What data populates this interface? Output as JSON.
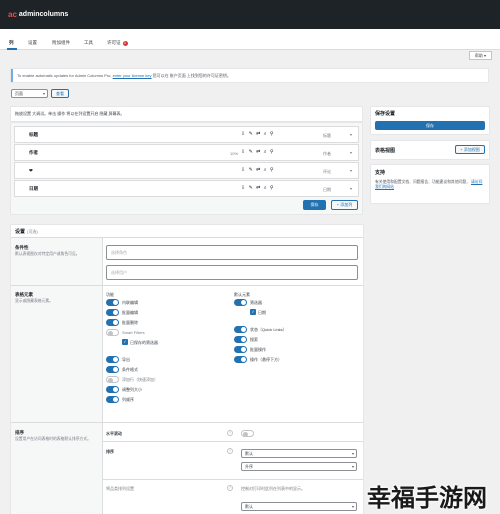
{
  "brand": {
    "mark": "ac",
    "name": "admincolumns"
  },
  "tabs": [
    {
      "label": "列"
    },
    {
      "label": "设置"
    },
    {
      "label": "附加组件"
    },
    {
      "label": "工具"
    },
    {
      "label": "许可证",
      "badge": "1"
    }
  ],
  "help_button": "帮助 ▾",
  "notice": {
    "text": "To enable automatic updates for Admin Columns Pro,",
    "link": "enter your license key",
    "text2": "您可以在 账户页面 上找到您的许可证密钥。"
  },
  "list_screen": {
    "select_value": "页面",
    "select_caret": "▾",
    "view_button": "查看"
  },
  "columns_intro": "拖放设置 大调试。单击 操作 将以在列设置开启 隐藏 屏幕表。",
  "columns": [
    {
      "label": "标题",
      "width": "",
      "type": "标题"
    },
    {
      "label": "作者",
      "width": "10%",
      "type": "作者"
    },
    {
      "label": "❤",
      "width": "",
      "type": "评论"
    },
    {
      "label": "日期",
      "width": "",
      "type": "日期"
    }
  ],
  "column_icons": "⇩ ✎ ⇄ ⌕ ⚲",
  "column_chevron": "▾",
  "save_button": "保存",
  "add_column_button": "+ 添加列",
  "sidebar": {
    "save_title": "保存设置",
    "save_button": "保存",
    "table_view_title": "表格视图",
    "add_view_button": "+ 添加视图",
    "support_title": "支持",
    "support_text": "有关使用和配置文档、问题报告、功能建议和其他问题，",
    "support_link": "请访问我们的网站"
  },
  "settings": {
    "title": "设置",
    "subtitle": "(可选)",
    "conditionals_label": "条件性",
    "conditionals_desc": "默认表视图仅对特定用户或角色可见。",
    "user_placeholder": "选择角色",
    "user_placeholder2": "选择用户",
    "table_elements_label": "表格元素",
    "table_elements_desc": "显示或隐藏表格元素。",
    "features_title": "功能",
    "features": [
      {
        "label": "内联编辑",
        "on": true
      },
      {
        "label": "批量编辑",
        "on": true
      },
      {
        "label": "批量删除",
        "on": true
      },
      {
        "label": "Smart Filters",
        "on": false
      },
      {
        "label": "已保存的筛选器",
        "checkbox": true
      },
      {
        "label": "导出",
        "on": true
      },
      {
        "label": "条件格式",
        "on": true
      },
      {
        "label": "添加行（快速添加）",
        "on": false
      },
      {
        "label": "调整列大小",
        "on": true
      },
      {
        "label": "列顺序",
        "on": true
      }
    ],
    "default_title": "默认元素",
    "defaults": [
      {
        "label": "筛选器",
        "on": true
      },
      {
        "label": "日期",
        "checkbox": true
      },
      {
        "label": "状态（Quick Links）",
        "on": true
      },
      {
        "label": "搜索",
        "on": true
      },
      {
        "label": "批量操作",
        "on": true
      },
      {
        "label": "操作（悬停下方）",
        "on": true
      }
    ],
    "sort_label": "排序",
    "sort_desc": "设置用户在访问表格时的表格默认排序方式。",
    "horizontal_scroll": "水平滚动",
    "order_label": "排序",
    "order_by": "默认",
    "order_dir": "升序",
    "primary_column_label": "将品类排列设置",
    "primary_column_desc": "控制对打印时此列在列表中的显示。",
    "primary_value": "默认"
  },
  "watermark": "幸福手游网"
}
